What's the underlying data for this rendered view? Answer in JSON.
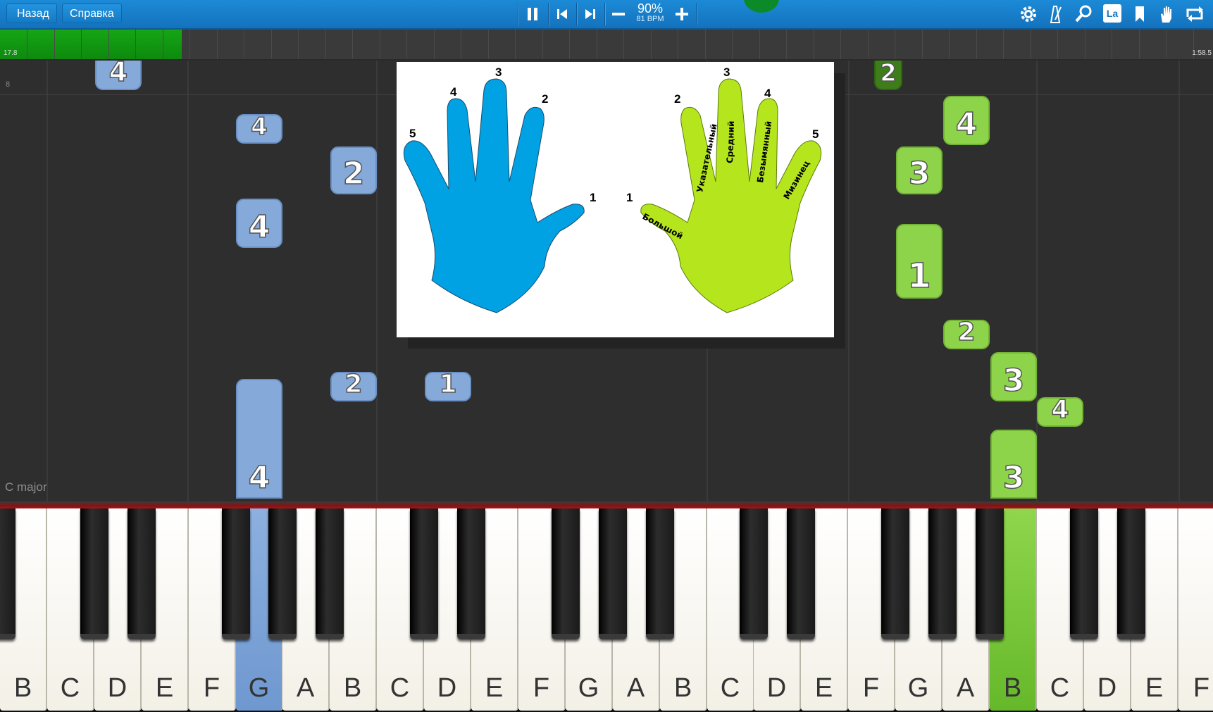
{
  "toolbar": {
    "back_label": "Назад",
    "help_label": "Справка",
    "speed_percent": "90%",
    "speed_bpm": "81 BPM",
    "icons": [
      "pause-icon",
      "skip-back-icon",
      "skip-forward-icon",
      "minus-icon",
      "plus-icon",
      "settings-gear-icon",
      "metronome-icon",
      "zoom-icon",
      "note-labels-icon",
      "bookmark-icon",
      "hand-icon",
      "loop-icon"
    ],
    "note_labels_text": "La",
    "accent": "#1680cc"
  },
  "timeline": {
    "current_time": "17.8",
    "total_time": "1:58.5",
    "progress": 0.15
  },
  "roll": {
    "measure_number": "8",
    "key_signature": "C major",
    "notes_left_color": "#85a9d9",
    "notes_right_color": "#8ed44a",
    "notes": [
      {
        "finger": "4",
        "hand": "left"
      },
      {
        "finger": "4",
        "hand": "left"
      },
      {
        "finger": "2",
        "hand": "left"
      },
      {
        "finger": "4",
        "hand": "left"
      },
      {
        "finger": "2",
        "hand": "left"
      },
      {
        "finger": "1",
        "hand": "left"
      },
      {
        "finger": "4",
        "hand": "left"
      },
      {
        "finger": "2",
        "hand": "right"
      },
      {
        "finger": "4",
        "hand": "right"
      },
      {
        "finger": "3",
        "hand": "right"
      },
      {
        "finger": "1",
        "hand": "right"
      },
      {
        "finger": "2",
        "hand": "right"
      },
      {
        "finger": "3",
        "hand": "right"
      },
      {
        "finger": "4",
        "hand": "right"
      },
      {
        "finger": "3",
        "hand": "right"
      }
    ]
  },
  "hand_chart": {
    "left_color": "#00a2e3",
    "right_color": "#b5e61d",
    "left_numbers": [
      "5",
      "4",
      "3",
      "2",
      "1"
    ],
    "right_numbers": [
      "1",
      "2",
      "3",
      "4",
      "5"
    ],
    "finger_names": [
      "Большой",
      "Указательный",
      "Средний",
      "Безымянный",
      "Мизинец"
    ]
  },
  "keyboard": {
    "white_keys": [
      "B",
      "C",
      "D",
      "E",
      "F",
      "G",
      "A",
      "B",
      "C",
      "D",
      "E",
      "F",
      "G",
      "A",
      "B",
      "C",
      "D",
      "E",
      "F",
      "G",
      "A",
      "B",
      "C",
      "D",
      "E",
      "F"
    ],
    "active_left_key": "G",
    "active_right_key": "B"
  }
}
